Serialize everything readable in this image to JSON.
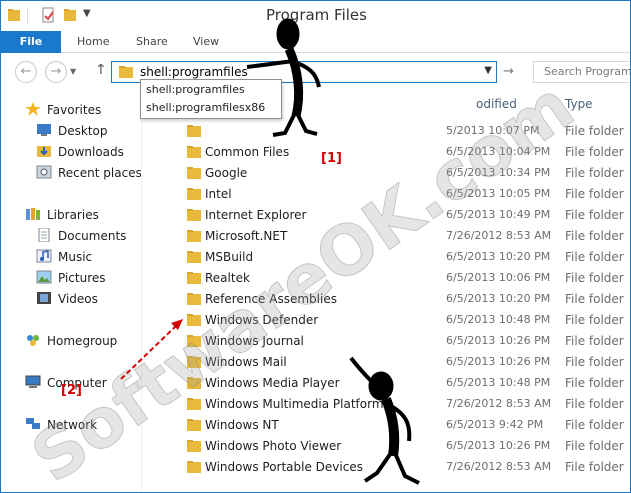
{
  "window": {
    "title": "Program Files"
  },
  "ribbon": {
    "tabs": [
      "File",
      "Home",
      "Share",
      "View"
    ]
  },
  "address": {
    "value": "shell:programfiles",
    "search_placeholder": "Search Program"
  },
  "autocomplete": [
    "shell:programfiles",
    "shell:programfilesx86"
  ],
  "sidebar": {
    "favorites_label": "Favorites",
    "favorites": [
      "Desktop",
      "Downloads",
      "Recent places"
    ],
    "libraries_label": "Libraries",
    "libraries": [
      "Documents",
      "Music",
      "Pictures",
      "Videos"
    ],
    "homegroup": "Homegroup",
    "computer": "Computer",
    "network": "Network"
  },
  "columns": {
    "modified": "odified",
    "type": "Type"
  },
  "files": [
    {
      "name": "",
      "date": "5/2013 10:07 PM",
      "type": "File folder"
    },
    {
      "name": "Common Files",
      "date": "6/5/2013 10:04 PM",
      "type": "File folder"
    },
    {
      "name": "Google",
      "date": "6/5/2013 10:34 PM",
      "type": "File folder"
    },
    {
      "name": "Intel",
      "date": "6/5/2013 10:05 PM",
      "type": "File folder"
    },
    {
      "name": "Internet Explorer",
      "date": "6/5/2013 10:49 PM",
      "type": "File folder"
    },
    {
      "name": "Microsoft.NET",
      "date": "7/26/2012 8:53 AM",
      "type": "File folder"
    },
    {
      "name": "MSBuild",
      "date": "6/5/2013 10:20 PM",
      "type": "File folder"
    },
    {
      "name": "Realtek",
      "date": "6/5/2013 10:06 PM",
      "type": "File folder"
    },
    {
      "name": "Reference Assemblies",
      "date": "6/5/2013 10:20 PM",
      "type": "File folder"
    },
    {
      "name": "Windows Defender",
      "date": "6/5/2013 10:48 PM",
      "type": "File folder"
    },
    {
      "name": "Windows Journal",
      "date": "6/5/2013 10:26 PM",
      "type": "File folder"
    },
    {
      "name": "Windows Mail",
      "date": "6/5/2013 10:26 PM",
      "type": "File folder"
    },
    {
      "name": "Windows Media Player",
      "date": "6/5/2013 10:48 PM",
      "type": "File folder"
    },
    {
      "name": "Windows Multimedia Platform",
      "date": "7/26/2012 8:53 AM",
      "type": "File folder"
    },
    {
      "name": "Windows NT",
      "date": "6/5/2013 9:42 PM",
      "type": "File folder"
    },
    {
      "name": "Windows Photo Viewer",
      "date": "6/5/2013 10:26 PM",
      "type": "File folder"
    },
    {
      "name": "Windows Portable Devices",
      "date": "7/26/2012 8:53 AM",
      "type": "File folder"
    }
  ],
  "annotations": {
    "one": "[1]",
    "two": "[2]"
  },
  "watermark": "SoftwareOK.com",
  "colors": {
    "accent": "#1979ca",
    "folder": "#e8b93a",
    "annotation": "#d40000"
  }
}
